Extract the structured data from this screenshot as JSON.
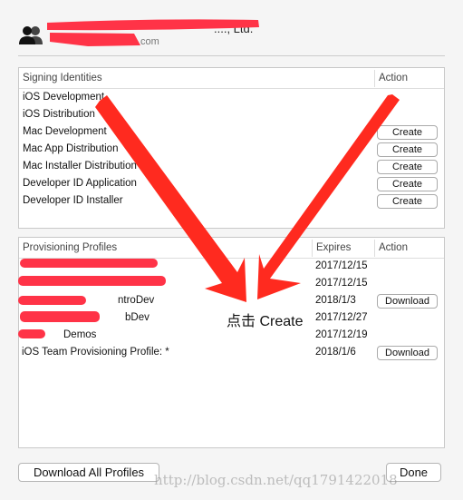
{
  "header": {
    "team_name_visible": "...., Ltd.",
    "team_sub_visible": "com",
    "icon": "team-icon"
  },
  "signing": {
    "columns": [
      "Signing Identities",
      "Action"
    ],
    "rows": [
      {
        "name": "iOS Development",
        "action": ""
      },
      {
        "name": "iOS Distribution",
        "action": ""
      },
      {
        "name": "Mac Development",
        "action": "Create"
      },
      {
        "name": "Mac App Distribution",
        "action": "Create"
      },
      {
        "name": "Mac Installer Distribution",
        "action": "Create"
      },
      {
        "name": "Developer ID Application",
        "action": "Create"
      },
      {
        "name": "Developer ID Installer",
        "action": "Create"
      }
    ]
  },
  "profiles": {
    "columns": [
      "Provisioning Profiles",
      "Expires",
      "Action"
    ],
    "rows": [
      {
        "name": "",
        "expires": "2017/12/15",
        "action": ""
      },
      {
        "name": "",
        "expires": "2017/12/15",
        "action": ""
      },
      {
        "name": "ntroDev",
        "expires": "2018/1/3",
        "action": "Download"
      },
      {
        "name": "bDev",
        "expires": "2017/12/27",
        "action": ""
      },
      {
        "name": "Demos",
        "expires": "2017/12/19",
        "action": ""
      },
      {
        "name": "iOS Team Provisioning Profile: *",
        "expires": "2018/1/6",
        "action": "Download"
      }
    ]
  },
  "footer": {
    "download_all": "Download All Profiles",
    "done": "Done"
  },
  "annotation": {
    "text": "点击 Create",
    "color": "#ff2a1f"
  },
  "watermark": "http://blog.csdn.net/qq1791422018"
}
